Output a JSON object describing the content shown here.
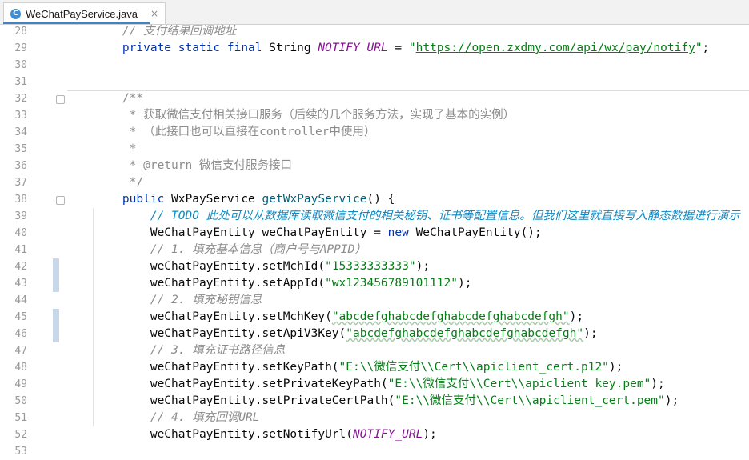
{
  "tab": {
    "icon_letter": "C",
    "file_name": "WeChatPayService.java",
    "close_glyph": "×"
  },
  "lines": [
    {
      "num": "28",
      "parts": [
        {
          "t": "    ",
          "c": ""
        },
        {
          "t": "// 支付结果回调地址",
          "c": "cm"
        }
      ]
    },
    {
      "num": "29",
      "parts": [
        {
          "t": "    ",
          "c": ""
        },
        {
          "t": "private static final ",
          "c": "kw"
        },
        {
          "t": "String ",
          "c": ""
        },
        {
          "t": "NOTIFY_URL",
          "c": "fld"
        },
        {
          "t": " = ",
          "c": ""
        },
        {
          "t": "\"",
          "c": "str"
        },
        {
          "t": "https://open.zxdmy.com/api/wx/pay/notify",
          "c": "str link"
        },
        {
          "t": "\"",
          "c": "str"
        },
        {
          "t": ";",
          "c": ""
        }
      ]
    },
    {
      "num": "30",
      "parts": []
    },
    {
      "num": "31",
      "parts": []
    },
    {
      "num": "32",
      "parts": [
        {
          "t": "    ",
          "c": ""
        },
        {
          "t": "/**",
          "c": "doc"
        }
      ]
    },
    {
      "num": "33",
      "parts": [
        {
          "t": "     ",
          "c": ""
        },
        {
          "t": "* 获取微信支付相关接口服务（后续的几个服务方法，实现了基本的实例）",
          "c": "doc"
        }
      ]
    },
    {
      "num": "34",
      "parts": [
        {
          "t": "     ",
          "c": ""
        },
        {
          "t": "* （此接口也可以直接在controller中使用）",
          "c": "doc"
        }
      ]
    },
    {
      "num": "35",
      "parts": [
        {
          "t": "     ",
          "c": ""
        },
        {
          "t": "*",
          "c": "doc"
        }
      ]
    },
    {
      "num": "36",
      "parts": [
        {
          "t": "     ",
          "c": ""
        },
        {
          "t": "* ",
          "c": "doc"
        },
        {
          "t": "@return",
          "c": "tag"
        },
        {
          "t": " 微信支付服务接口",
          "c": "doc"
        }
      ]
    },
    {
      "num": "37",
      "parts": [
        {
          "t": "     ",
          "c": ""
        },
        {
          "t": "*/",
          "c": "doc"
        }
      ]
    },
    {
      "num": "38",
      "parts": [
        {
          "t": "    ",
          "c": ""
        },
        {
          "t": "public ",
          "c": "kw"
        },
        {
          "t": "WxPayService ",
          "c": ""
        },
        {
          "t": "getWxPayService",
          "c": "meth"
        },
        {
          "t": "() {",
          "c": ""
        }
      ]
    },
    {
      "num": "39",
      "parts": [
        {
          "t": "        ",
          "c": ""
        },
        {
          "t": "// ",
          "c": "todo"
        },
        {
          "t": "TODO 此处可以从数据库读取微信支付的相关秘钥、证书等配置信息。但我们这里就直接写入静态数据进行演示",
          "c": "todo"
        }
      ]
    },
    {
      "num": "40",
      "parts": [
        {
          "t": "        WeChatPayEntity weChatPayEntity = ",
          "c": ""
        },
        {
          "t": "new ",
          "c": "kw"
        },
        {
          "t": "WeChatPayEntity();",
          "c": ""
        }
      ]
    },
    {
      "num": "41",
      "parts": [
        {
          "t": "        ",
          "c": ""
        },
        {
          "t": "// 1. 填充基本信息（商户号与APPID）",
          "c": "cm"
        }
      ]
    },
    {
      "num": "42",
      "parts": [
        {
          "t": "        weChatPayEntity.setMchId(",
          "c": ""
        },
        {
          "t": "\"15333333333\"",
          "c": "str"
        },
        {
          "t": ");",
          "c": ""
        }
      ]
    },
    {
      "num": "43",
      "parts": [
        {
          "t": "        weChatPayEntity.setAppId(",
          "c": ""
        },
        {
          "t": "\"wx123456789101112\"",
          "c": "str"
        },
        {
          "t": ");",
          "c": ""
        }
      ]
    },
    {
      "num": "44",
      "parts": [
        {
          "t": "        ",
          "c": ""
        },
        {
          "t": "// 2. 填充秘钥信息",
          "c": "cm"
        }
      ]
    },
    {
      "num": "45",
      "parts": [
        {
          "t": "        weChatPayEntity.setMchKey(",
          "c": ""
        },
        {
          "t": "\"abcdefghabcdefghabcdefghabcdefgh\"",
          "c": "str sq"
        },
        {
          "t": ");",
          "c": ""
        }
      ]
    },
    {
      "num": "46",
      "parts": [
        {
          "t": "        weChatPayEntity.setApiV3Key(",
          "c": ""
        },
        {
          "t": "\"abcdefghabcdefghabcdefghabcdefgh\"",
          "c": "str sq"
        },
        {
          "t": ");",
          "c": ""
        }
      ]
    },
    {
      "num": "47",
      "parts": [
        {
          "t": "        ",
          "c": ""
        },
        {
          "t": "// 3. 填充证书路径信息",
          "c": "cm"
        }
      ]
    },
    {
      "num": "48",
      "parts": [
        {
          "t": "        weChatPayEntity.setKeyPath(",
          "c": ""
        },
        {
          "t": "\"E:\\\\微信支付\\\\Cert\\\\apiclient_cert.p12\"",
          "c": "str"
        },
        {
          "t": ");",
          "c": ""
        }
      ]
    },
    {
      "num": "49",
      "parts": [
        {
          "t": "        weChatPayEntity.setPrivateKeyPath(",
          "c": ""
        },
        {
          "t": "\"E:\\\\微信支付\\\\Cert\\\\apiclient_key.pem\"",
          "c": "str"
        },
        {
          "t": ");",
          "c": ""
        }
      ]
    },
    {
      "num": "50",
      "parts": [
        {
          "t": "        weChatPayEntity.setPrivateCertPath(",
          "c": ""
        },
        {
          "t": "\"E:\\\\微信支付\\\\Cert\\\\apiclient_cert.pem\"",
          "c": "str"
        },
        {
          "t": ");",
          "c": ""
        }
      ]
    },
    {
      "num": "51",
      "parts": [
        {
          "t": "        ",
          "c": ""
        },
        {
          "t": "// 4. 填充回调URL",
          "c": "cm"
        }
      ]
    },
    {
      "num": "52",
      "parts": [
        {
          "t": "        weChatPayEntity.setNotifyUrl(",
          "c": ""
        },
        {
          "t": "NOTIFY_URL",
          "c": "fld"
        },
        {
          "t": ");",
          "c": ""
        }
      ]
    },
    {
      "num": "53",
      "parts": []
    }
  ]
}
